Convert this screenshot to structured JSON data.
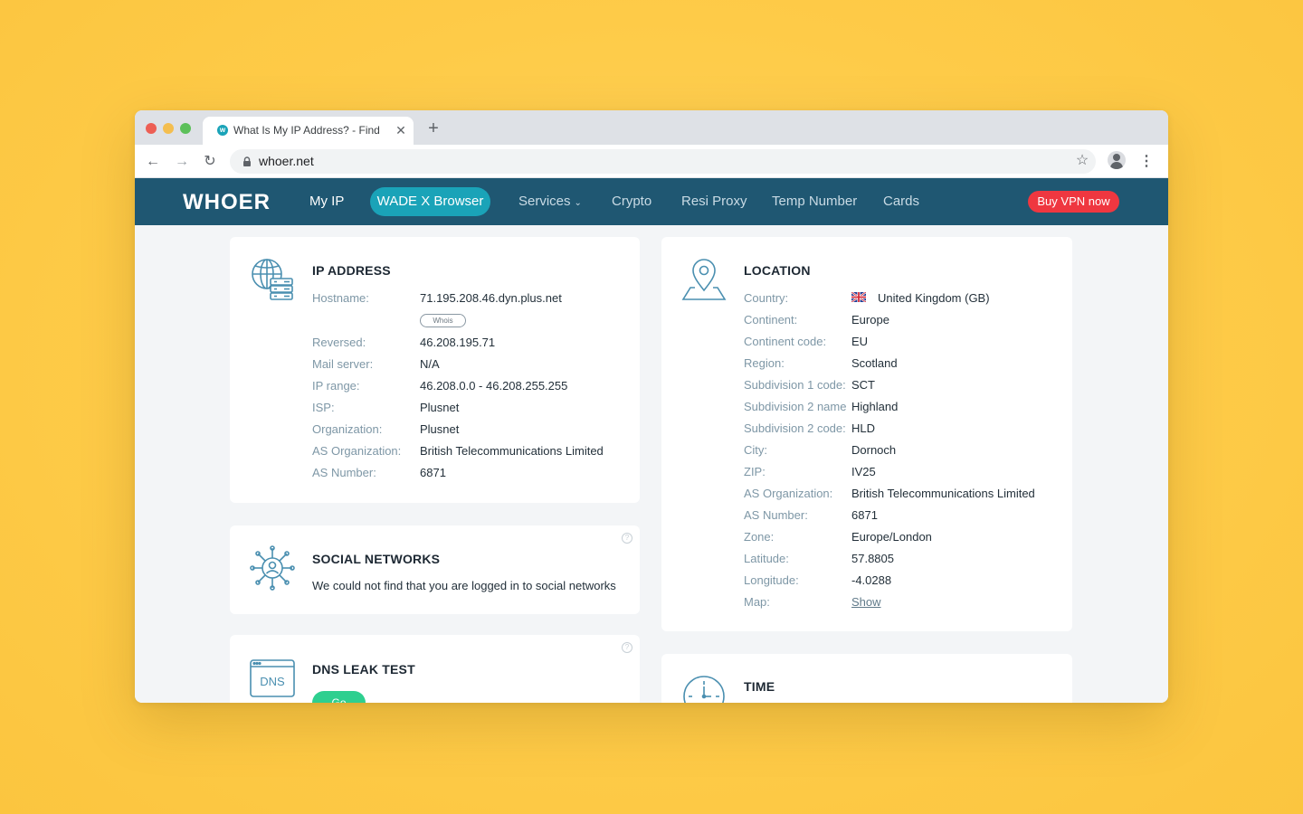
{
  "browser": {
    "tab_title": "What Is My IP Address? - Find",
    "url": "whoer.net"
  },
  "nav": {
    "logo": "WHOER",
    "links": [
      "My IP",
      "WADE X Browser",
      "Services",
      "Crypto",
      "Resi Proxy",
      "Temp Number",
      "Cards"
    ],
    "buy_label": "Buy VPN now"
  },
  "ip_card": {
    "title": "IP ADDRESS",
    "whois_label": "Whois",
    "rows": [
      {
        "label": "Hostname:",
        "value": "71.195.208.46.dyn.plus.net"
      },
      {
        "label": "Reversed:",
        "value": "46.208.195.71"
      },
      {
        "label": "Mail server:",
        "value": "N/A"
      },
      {
        "label": "IP range:",
        "value": "46.208.0.0 - 46.208.255.255"
      },
      {
        "label": "ISP:",
        "value": "Plusnet"
      },
      {
        "label": "Organization:",
        "value": "Plusnet"
      },
      {
        "label": "AS Organization:",
        "value": "British Telecommunications Limited"
      },
      {
        "label": "AS Number:",
        "value": "6871"
      }
    ]
  },
  "social_card": {
    "title": "SOCIAL NETWORKS",
    "text": "We could not find that you are logged in to social networks"
  },
  "dns_card": {
    "title": "DNS LEAK TEST",
    "icon_text": "DNS",
    "button_label": "Go"
  },
  "location_card": {
    "title": "LOCATION",
    "rows": [
      {
        "label": "Country:",
        "value": "United Kingdom (GB)"
      },
      {
        "label": "Continent:",
        "value": "Europe"
      },
      {
        "label": "Continent code:",
        "value": "EU"
      },
      {
        "label": "Region:",
        "value": "Scotland"
      },
      {
        "label": "Subdivision 1 code:",
        "value": "SCT"
      },
      {
        "label": "Subdivision 2 name",
        "value": "Highland"
      },
      {
        "label": "Subdivision 2 code:",
        "value": "HLD"
      },
      {
        "label": "City:",
        "value": "Dornoch"
      },
      {
        "label": "ZIP:",
        "value": "IV25"
      },
      {
        "label": "AS Organization:",
        "value": "British Telecommunications Limited"
      },
      {
        "label": "AS Number:",
        "value": "6871"
      },
      {
        "label": "Zone:",
        "value": "Europe/London"
      },
      {
        "label": "Latitude:",
        "value": "57.8805"
      },
      {
        "label": "Longitude:",
        "value": "-4.0288"
      },
      {
        "label": "Map:",
        "value": "Show"
      }
    ]
  },
  "time_card": {
    "title": "TIME"
  }
}
